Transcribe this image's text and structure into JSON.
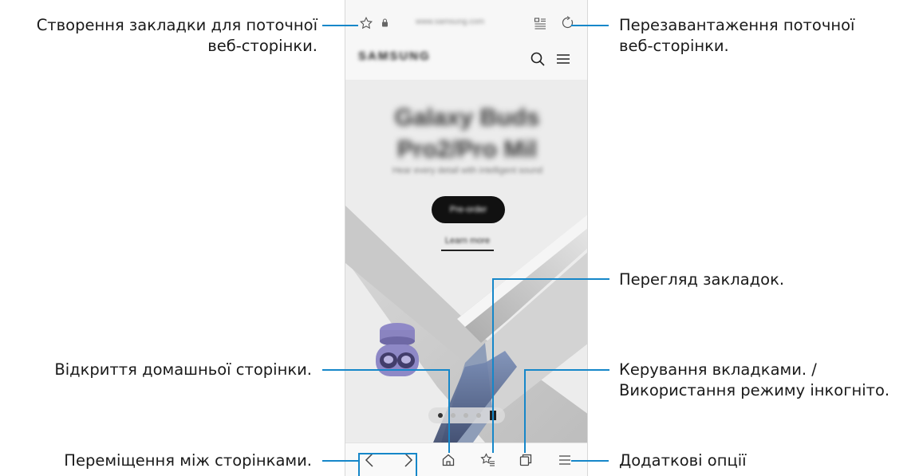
{
  "labels": {
    "bookmark_add": [
      "Створення закладки для поточної",
      "веб-сторінки."
    ],
    "reload": [
      "Перезавантаження поточної",
      "веб-сторінки."
    ],
    "bookmarks_view": "Перегляд закладок.",
    "home": "Відкриття домашньої сторінки.",
    "tabs": [
      "Керування вкладками. /",
      "Використання режиму інкогніто."
    ],
    "navigate": "Переміщення між сторінками.",
    "more": "Додаткові опції"
  },
  "browser": {
    "url": "www.samsung.com",
    "brand": "SAMSUNG",
    "hero_title": [
      "Galaxy Buds",
      "Pro2/Pro Mil"
    ],
    "hero_subtitle": "Hear every detail with intelligent sound",
    "cta_label": "Pre-order",
    "learn_more": "Learn more",
    "carousel_slides": 5,
    "carousel_active": 1
  },
  "icons": {
    "bookmark_add": "star-outline-icon",
    "lock": "lock-icon",
    "reader": "reader-mode-icon",
    "reload": "reload-icon",
    "search": "search-icon",
    "menu": "hamburger-icon",
    "back": "chevron-left-icon",
    "forward": "chevron-right-icon",
    "home": "home-icon",
    "bookmarks": "bookmark-list-icon",
    "tabs": "tabs-icon",
    "more": "more-menu-icon"
  },
  "colors": {
    "callout": "#1687c9",
    "cta_bg": "#111111",
    "panel_bg": "#f2f2f2"
  }
}
